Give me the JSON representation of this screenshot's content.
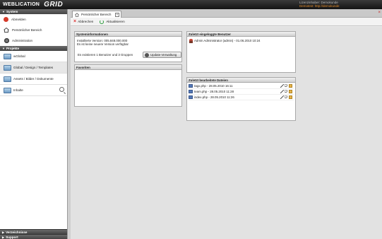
{
  "app": {
    "logo_main": "WEBLICATION",
    "logo_sub": "GRID",
    "license_line1": "Lizenzinhaber: Demokunde",
    "license_line2": "Demotest: http://demokunde"
  },
  "sidebar": {
    "system_header": "System",
    "system_items": [
      {
        "label": "Abmelden",
        "icon": "logout-icon"
      },
      {
        "label": "Persönlicher Bereich",
        "icon": "home-icon"
      },
      {
        "label": "Administration",
        "icon": "gear-icon"
      }
    ],
    "projects_header": "Projekte",
    "project_items": [
      {
        "label": "wGlobal",
        "icon": "project-icon"
      },
      {
        "label": "Global / Design / Templates",
        "icon": "project-icon"
      },
      {
        "label": "Assets / Bilder / Dokumente",
        "icon": "project-icon"
      },
      {
        "label": "Inhalte",
        "icon": "project-icon"
      }
    ],
    "bottom_headers": [
      "Verzeichnisse",
      "Support"
    ]
  },
  "main": {
    "tab_label": "Persönlicher Bereich",
    "toolbar": {
      "cancel_label": "Abbrechen",
      "refresh_label": "Aktualisieren"
    },
    "sysinfo": {
      "title": "Systeminformationen",
      "lines": [
        "Installierte Version: 005.848.000.000",
        "Es ist keine neuere Version verfügbar"
      ],
      "summary": "Es existieren 1 Benutzer und 3 Gruppen",
      "button_label": "Update-Verwaltung"
    },
    "favorites": {
      "title": "Favoriten"
    },
    "users": {
      "title": "Zuletzt eingeloggte Benutzer",
      "rows": [
        "Admin Administrator (admin) - 01.06.2010 10:24"
      ]
    },
    "files": {
      "title": "Zuletzt bearbeitete Dateien",
      "rows": [
        "tagx.php - 28.05.2010 16:11",
        "team.php - 28.05.2010 11:28",
        "index.php - 28.05.2010 11:26"
      ]
    }
  }
}
